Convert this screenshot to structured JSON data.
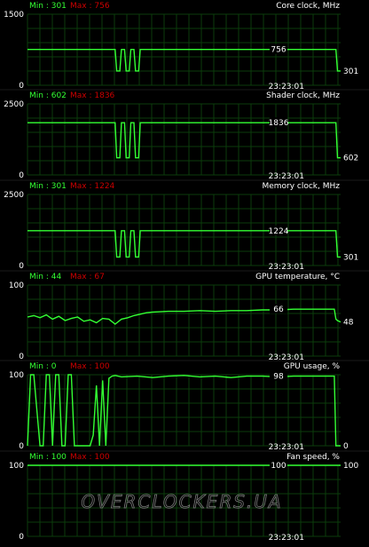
{
  "timestamp": "23:23:01",
  "watermark": "OVERCLOCKERS.UA",
  "colors": {
    "background": "#000000",
    "grid": "#0b3d0b",
    "line": "#33ff33",
    "min_label": "#33ff33",
    "max_label": "#cc0000",
    "text": "#ffffff"
  },
  "chart_data": [
    {
      "type": "line",
      "title": "Core clock, MHz",
      "min_label": "Min : 301",
      "max_label": "Max : 756",
      "ymax_label": "1500",
      "ymin_label": "0",
      "ylim": [
        0,
        1500
      ],
      "current_label": "756",
      "end_label": "301",
      "x": [
        0,
        0.28,
        0.285,
        0.295,
        0.3,
        0.31,
        0.315,
        0.325,
        0.33,
        0.34,
        0.345,
        0.355,
        0.36,
        0.985,
        0.99,
        1.0
      ],
      "y": [
        756,
        756,
        301,
        301,
        756,
        756,
        301,
        301,
        756,
        756,
        301,
        301,
        756,
        756,
        301,
        301
      ]
    },
    {
      "type": "line",
      "title": "Shader clock, MHz",
      "min_label": "Min : 602",
      "max_label": "Max : 1836",
      "ymax_label": "2500",
      "ymin_label": "0",
      "ylim": [
        0,
        2500
      ],
      "current_label": "1836",
      "end_label": "602",
      "x": [
        0,
        0.28,
        0.285,
        0.295,
        0.3,
        0.31,
        0.315,
        0.325,
        0.33,
        0.34,
        0.345,
        0.355,
        0.36,
        0.985,
        0.99,
        1.0
      ],
      "y": [
        1836,
        1836,
        602,
        602,
        1836,
        1836,
        602,
        602,
        1836,
        1836,
        602,
        602,
        1836,
        1836,
        602,
        602
      ]
    },
    {
      "type": "line",
      "title": "Memory clock, MHz",
      "min_label": "Min : 301",
      "max_label": "Max : 1224",
      "ymax_label": "2500",
      "ymin_label": "0",
      "ylim": [
        0,
        2500
      ],
      "current_label": "1224",
      "end_label": "301",
      "x": [
        0,
        0.28,
        0.285,
        0.295,
        0.3,
        0.31,
        0.315,
        0.325,
        0.33,
        0.34,
        0.345,
        0.355,
        0.36,
        0.985,
        0.99,
        1.0
      ],
      "y": [
        1224,
        1224,
        301,
        301,
        1224,
        1224,
        301,
        301,
        1224,
        1224,
        301,
        301,
        1224,
        1224,
        301,
        301
      ]
    },
    {
      "type": "line",
      "title": "GPU temperature, °C",
      "min_label": "Min : 44",
      "max_label": "Max : 67",
      "ymax_label": "100",
      "ymin_label": "0",
      "ylim": [
        0,
        100
      ],
      "current_label": "66",
      "end_label": "48",
      "x": [
        0,
        0.02,
        0.04,
        0.06,
        0.08,
        0.1,
        0.12,
        0.14,
        0.16,
        0.18,
        0.2,
        0.22,
        0.24,
        0.26,
        0.28,
        0.3,
        0.32,
        0.34,
        0.36,
        0.38,
        0.4,
        0.45,
        0.5,
        0.55,
        0.6,
        0.65,
        0.7,
        0.75,
        0.8,
        0.85,
        0.9,
        0.95,
        0.98,
        0.985,
        0.99,
        1.0
      ],
      "y": [
        55,
        57,
        54,
        58,
        52,
        56,
        50,
        53,
        55,
        49,
        51,
        47,
        53,
        52,
        45,
        52,
        54,
        57,
        59,
        61,
        62,
        63,
        63,
        64,
        63,
        64,
        64,
        65,
        65,
        66,
        66,
        66,
        66,
        52,
        50,
        48
      ]
    },
    {
      "type": "line",
      "title": "GPU usage, %",
      "min_label": "Min : 0",
      "max_label": "Max : 100",
      "ymax_label": "100",
      "ymin_label": "0",
      "ylim": [
        0,
        100
      ],
      "current_label": "98",
      "end_label": "0",
      "x": [
        0,
        0.01,
        0.02,
        0.04,
        0.05,
        0.06,
        0.07,
        0.08,
        0.09,
        0.1,
        0.11,
        0.12,
        0.13,
        0.14,
        0.15,
        0.16,
        0.17,
        0.2,
        0.21,
        0.22,
        0.23,
        0.24,
        0.25,
        0.26,
        0.27,
        0.28,
        0.3,
        0.35,
        0.4,
        0.45,
        0.5,
        0.55,
        0.6,
        0.65,
        0.7,
        0.75,
        0.8,
        0.85,
        0.9,
        0.95,
        0.98,
        0.985,
        1.0
      ],
      "y": [
        0,
        100,
        100,
        0,
        0,
        100,
        100,
        0,
        100,
        100,
        0,
        0,
        100,
        100,
        0,
        0,
        0,
        0,
        15,
        85,
        0,
        92,
        0,
        95,
        98,
        99,
        97,
        98,
        96,
        98,
        99,
        97,
        98,
        96,
        98,
        98,
        97,
        98,
        98,
        98,
        98,
        0,
        0
      ]
    },
    {
      "type": "line",
      "title": "Fan speed, %",
      "min_label": "Min : 100",
      "max_label": "Max : 100",
      "ymax_label": "100",
      "ymin_label": "0",
      "ylim": [
        0,
        100
      ],
      "current_label": "100",
      "end_label": "100",
      "x": [
        0,
        1.0
      ],
      "y": [
        100,
        100
      ]
    }
  ]
}
